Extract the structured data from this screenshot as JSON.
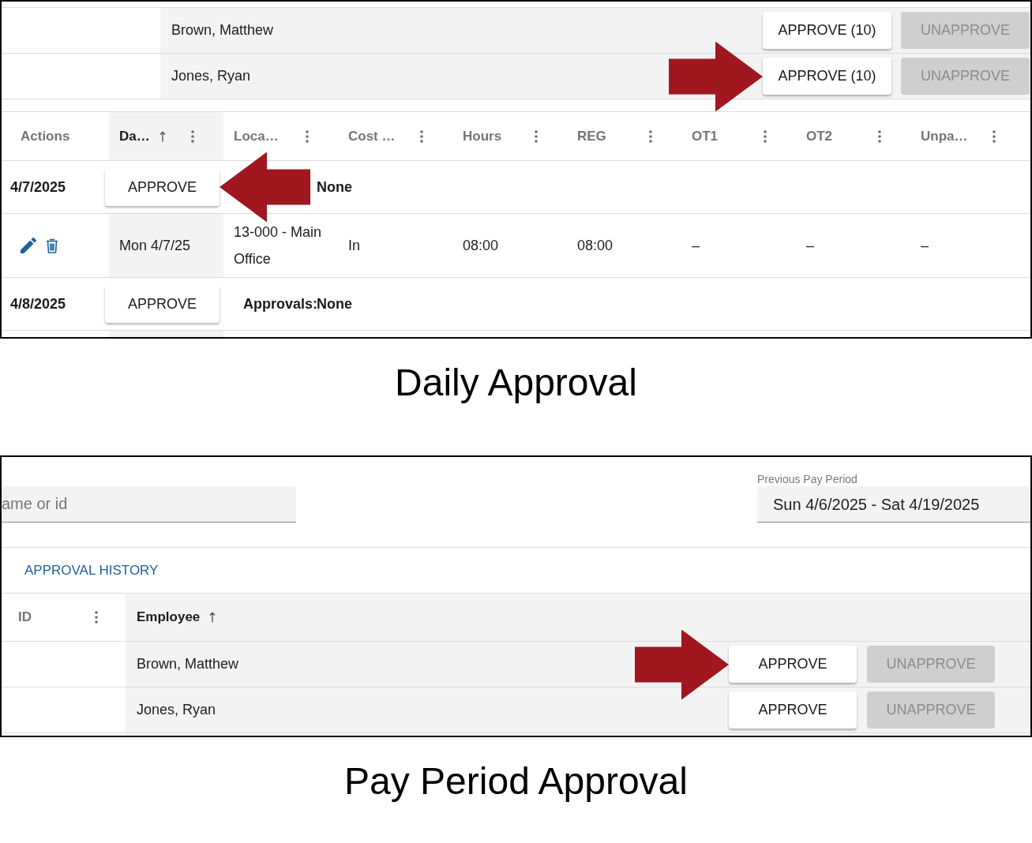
{
  "daily_approval": {
    "employees": [
      {
        "name": "Brown, Matthew",
        "approve_label": "APPROVE (10)",
        "unapprove_label": "UNAPPROVE",
        "unapprove_disabled": true,
        "arrow": false
      },
      {
        "name": "Jones, Ryan",
        "approve_label": "APPROVE (10)",
        "unapprove_label": "UNAPPROVE",
        "unapprove_disabled": true,
        "arrow": true
      }
    ],
    "columns": [
      {
        "label": "Actions",
        "sorted": false,
        "menu": false
      },
      {
        "label": "Da…",
        "sorted": true,
        "menu": true
      },
      {
        "label": "Loca…",
        "sorted": false,
        "menu": true
      },
      {
        "label": "Cost …",
        "sorted": false,
        "menu": true
      },
      {
        "label": "Hours",
        "sorted": false,
        "menu": true
      },
      {
        "label": "REG",
        "sorted": false,
        "menu": true
      },
      {
        "label": "OT1",
        "sorted": false,
        "menu": true
      },
      {
        "label": "OT2",
        "sorted": false,
        "menu": true
      },
      {
        "label": "Unpa…",
        "sorted": false,
        "menu": true
      }
    ],
    "days": [
      {
        "date": "4/7/2025",
        "approve_label": "APPROVE",
        "arrow": true,
        "approvals_value": "None",
        "entries": [
          {
            "cells": [
              "Mon 4/7/25",
              "13-000 - Main Office",
              "In",
              "08:00",
              "08:00",
              "–",
              "–",
              "–"
            ]
          }
        ]
      },
      {
        "date": "4/8/2025",
        "approve_label": "APPROVE",
        "arrow": false,
        "approvals_label": "Approvals:",
        "approvals_value": "None"
      }
    ],
    "caption": "Daily Approval"
  },
  "pay_period_approval": {
    "search": {
      "placeholder": "ame or id"
    },
    "pay_period": {
      "label": "Previous Pay Period",
      "value": "Sun 4/6/2025 - Sat 4/19/2025"
    },
    "history_button": "APPROVAL HISTORY",
    "columns": [
      {
        "label": "ID",
        "sorted": false,
        "menu": true
      },
      {
        "label": "Employee",
        "sorted": true,
        "menu": false
      }
    ],
    "employees": [
      {
        "name": "Brown, Matthew",
        "approve_label": "APPROVE",
        "unapprove_label": "UNAPPROVE",
        "unapprove_disabled": true,
        "arrow": true
      },
      {
        "name": "Jones, Ryan",
        "approve_label": "APPROVE",
        "unapprove_label": "UNAPPROVE",
        "unapprove_disabled": true,
        "arrow": false
      }
    ],
    "caption": "Pay Period Approval"
  }
}
